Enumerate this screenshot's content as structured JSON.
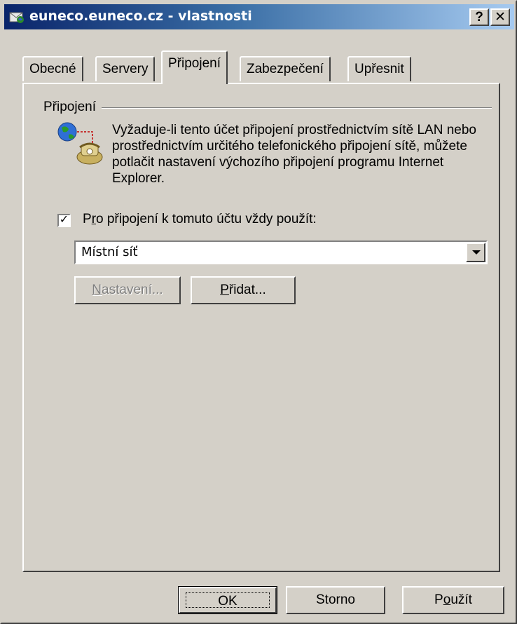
{
  "window": {
    "title": "euneco.euneco.cz - vlastnosti",
    "help_label": "?",
    "close_label": "✕"
  },
  "tabs": [
    {
      "label": "Obecné",
      "active": false
    },
    {
      "label": "Servery",
      "active": false
    },
    {
      "label": "Připojení",
      "active": true
    },
    {
      "label": "Zabezpečení",
      "active": false
    },
    {
      "label": "Upřesnit",
      "active": false
    }
  ],
  "group": {
    "title": "Připojení",
    "description": "Vyžaduje-li tento účet připojení prostřednictvím sítě LAN nebo prostřednictvím určitého telefonického připojení sítě, můžete potlačit nastavení výchozího připojení programu Internet Explorer."
  },
  "checkbox": {
    "checked": true,
    "label_before": "P",
    "label_underline": "r",
    "label_after": "o připojení k tomuto účtu vždy použít:"
  },
  "combo": {
    "value": "Místní síť"
  },
  "buttons": {
    "nastaveni_underline": "N",
    "nastaveni_rest": "astavení...",
    "pridat_underline": "P",
    "pridat_rest": "řidat...",
    "ok": "OK",
    "storno": "Storno",
    "pouzit_before": "P",
    "pouzit_underline": "o",
    "pouzit_after": "užít"
  },
  "colors": {
    "titlebar_start": "#0a246a",
    "face": "#d4d0c8"
  }
}
